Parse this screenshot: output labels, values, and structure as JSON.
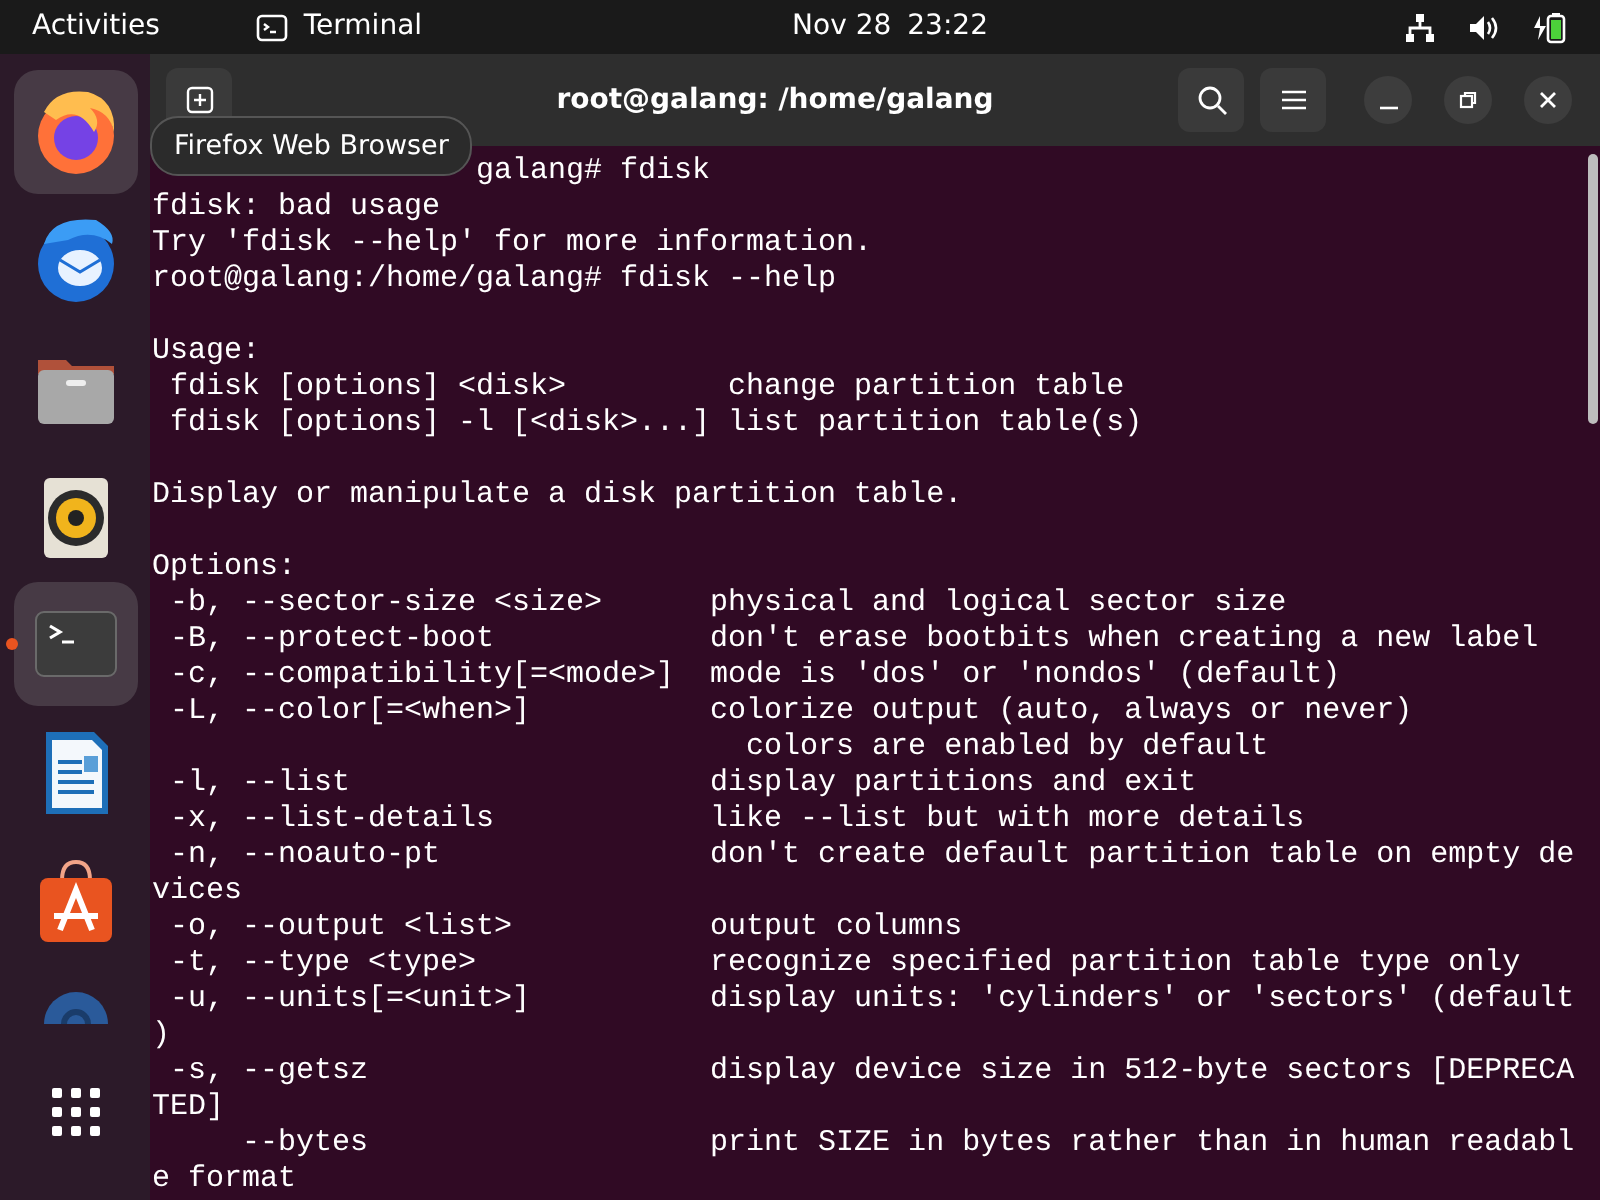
{
  "top_bar": {
    "activities": "Activities",
    "app_menu": "Terminal",
    "date": "Nov 28",
    "time": "23:22"
  },
  "dock": {
    "items": [
      {
        "kind": "browser",
        "highlighted": true,
        "running": false
      },
      {
        "kind": "mail",
        "highlighted": false,
        "running": false
      },
      {
        "kind": "files",
        "highlighted": false,
        "running": false
      },
      {
        "kind": "speaker",
        "highlighted": false,
        "running": false
      },
      {
        "kind": "terminal",
        "highlighted": true,
        "running": true
      },
      {
        "kind": "document",
        "highlighted": false,
        "running": false
      },
      {
        "kind": "store",
        "highlighted": false,
        "running": false
      },
      {
        "kind": "partial",
        "highlighted": false,
        "running": false
      },
      {
        "kind": "apps",
        "highlighted": false,
        "running": false
      }
    ]
  },
  "tooltip": "Firefox Web Browser",
  "window": {
    "title": "root@galang: /home/galang"
  },
  "terminal": {
    "lines": [
      {
        "kind": "covered",
        "text": "galang# fdisk"
      },
      {
        "text": "fdisk: bad usage"
      },
      {
        "text": "Try 'fdisk --help' for more information."
      },
      {
        "text": "root@galang:/home/galang# fdisk --help"
      },
      {
        "kind": "blank"
      },
      {
        "text": "Usage:"
      },
      {
        "text": " fdisk [options] <disk>         change partition table"
      },
      {
        "text": " fdisk [options] -l [<disk>...] list partition table(s)"
      },
      {
        "kind": "blank"
      },
      {
        "text": "Display or manipulate a disk partition table."
      },
      {
        "kind": "blank"
      },
      {
        "text": "Options:"
      },
      {
        "text": " -b, --sector-size <size>      physical and logical sector size"
      },
      {
        "text": " -B, --protect-boot            don't erase bootbits when creating a new label"
      },
      {
        "text": " -c, --compatibility[=<mode>]  mode is 'dos' or 'nondos' (default)"
      },
      {
        "text": " -L, --color[=<when>]          colorize output (auto, always or never)"
      },
      {
        "text": "                                 colors are enabled by default"
      },
      {
        "text": " -l, --list                    display partitions and exit"
      },
      {
        "text": " -x, --list-details            like --list but with more details"
      },
      {
        "text": " -n, --noauto-pt               don't create default partition table on empty de"
      },
      {
        "text": "vices"
      },
      {
        "text": " -o, --output <list>           output columns"
      },
      {
        "text": " -t, --type <type>             recognize specified partition table type only"
      },
      {
        "text": " -u, --units[=<unit>]          display units: 'cylinders' or 'sectors' (default"
      },
      {
        "text": ")"
      },
      {
        "text": " -s, --getsz                   display device size in 512-byte sectors [DEPRECA"
      },
      {
        "text": "TED]"
      },
      {
        "text": "     --bytes                   print SIZE in bytes rather than in human readabl"
      },
      {
        "text": "e format"
      }
    ]
  }
}
